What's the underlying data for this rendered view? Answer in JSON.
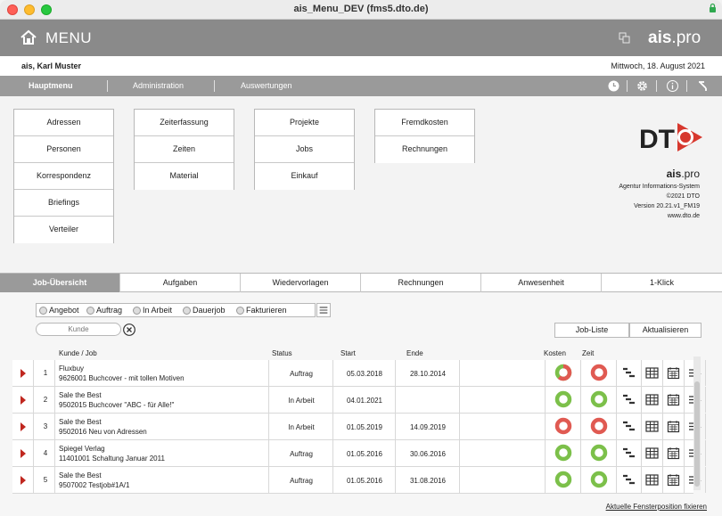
{
  "window": {
    "title": "ais_Menu_DEV (fms5.dto.de)"
  },
  "topbar": {
    "menu_label": "MENU",
    "brand_bold": "ais",
    "brand_rest": ".pro"
  },
  "user": {
    "name": "ais, Karl Muster",
    "date": "Mittwoch, 18. August 2021"
  },
  "nav": {
    "items": [
      "Hauptmenu",
      "Administration",
      "Auswertungen"
    ]
  },
  "menu": {
    "col1": [
      "Adressen",
      "Personen",
      "Korrespondenz",
      "Briefings",
      "Verteiler"
    ],
    "col2": [
      "Zeiterfassung",
      "Zeiten",
      "Material"
    ],
    "col3": [
      "Projekte",
      "Jobs",
      "Einkauf"
    ],
    "col4": [
      "Fremdkosten",
      "Rechnungen"
    ]
  },
  "logo": {
    "text": "DT"
  },
  "info": {
    "ais_bold": "ais",
    "ais_rest": ".pro",
    "line1": "Agentur Informations-System",
    "line2": "©2021 DTO",
    "line3": "Version 20.21.v1_FM19",
    "line4": "www.dto.de"
  },
  "tabs": [
    "Job-Übersicht",
    "Aufgaben",
    "Wiedervorlagen",
    "Rechnungen",
    "Anwesenheit",
    "1-Klick"
  ],
  "filters": [
    "Angebot",
    "Auftrag",
    "In Arbeit",
    "Dauerjob",
    "Fakturieren"
  ],
  "search": {
    "placeholder": "Kunde"
  },
  "actions": {
    "list": "Job-Liste",
    "refresh": "Aktualisieren"
  },
  "headers": {
    "kunde_job": "Kunde / Job",
    "status": "Status",
    "start": "Start",
    "ende": "Ende",
    "kosten": "Kosten",
    "zeit": "Zeit"
  },
  "rows": [
    {
      "num": "1",
      "customer": "Fluxbuy",
      "job": "9626001 Buchcover - mit tollen Motiven",
      "status": "Auftrag",
      "start": "05.03.2018",
      "end": "28.10.2014",
      "kosten": "red-green",
      "zeit": "red"
    },
    {
      "num": "2",
      "customer": "Sale the Best",
      "job": "9502015 Buchcover \"ABC -  für Alle!\"",
      "status": "In Arbeit",
      "start": "04.01.2021",
      "end": "",
      "kosten": "green",
      "zeit": "green"
    },
    {
      "num": "3",
      "customer": "Sale the Best",
      "job": "9502016 Neu von Adressen",
      "status": "In Arbeit",
      "start": "01.05.2019",
      "end": "14.09.2019",
      "kosten": "red",
      "zeit": "red"
    },
    {
      "num": "4",
      "customer": "Spiegel Verlag",
      "job": "11401001 Schaltung Januar 2011",
      "status": "Auftrag",
      "start": "01.05.2016",
      "end": "30.06.2016",
      "kosten": "green",
      "zeit": "green"
    },
    {
      "num": "5",
      "customer": "Sale the Best",
      "job": "9507002 Testjob#1A/1",
      "status": "Auftrag",
      "start": "01.05.2016",
      "end": "31.08.2016",
      "kosten": "green",
      "zeit": "green"
    }
  ],
  "footer": {
    "link": "Aktuelle Fensterposition fixieren"
  },
  "colors": {
    "topbar": "#8a8a8a",
    "navbar": "#9a9a9a",
    "accent_red": "#d7382e",
    "donut_green": "#7cc04a",
    "donut_red": "#e05a52"
  }
}
